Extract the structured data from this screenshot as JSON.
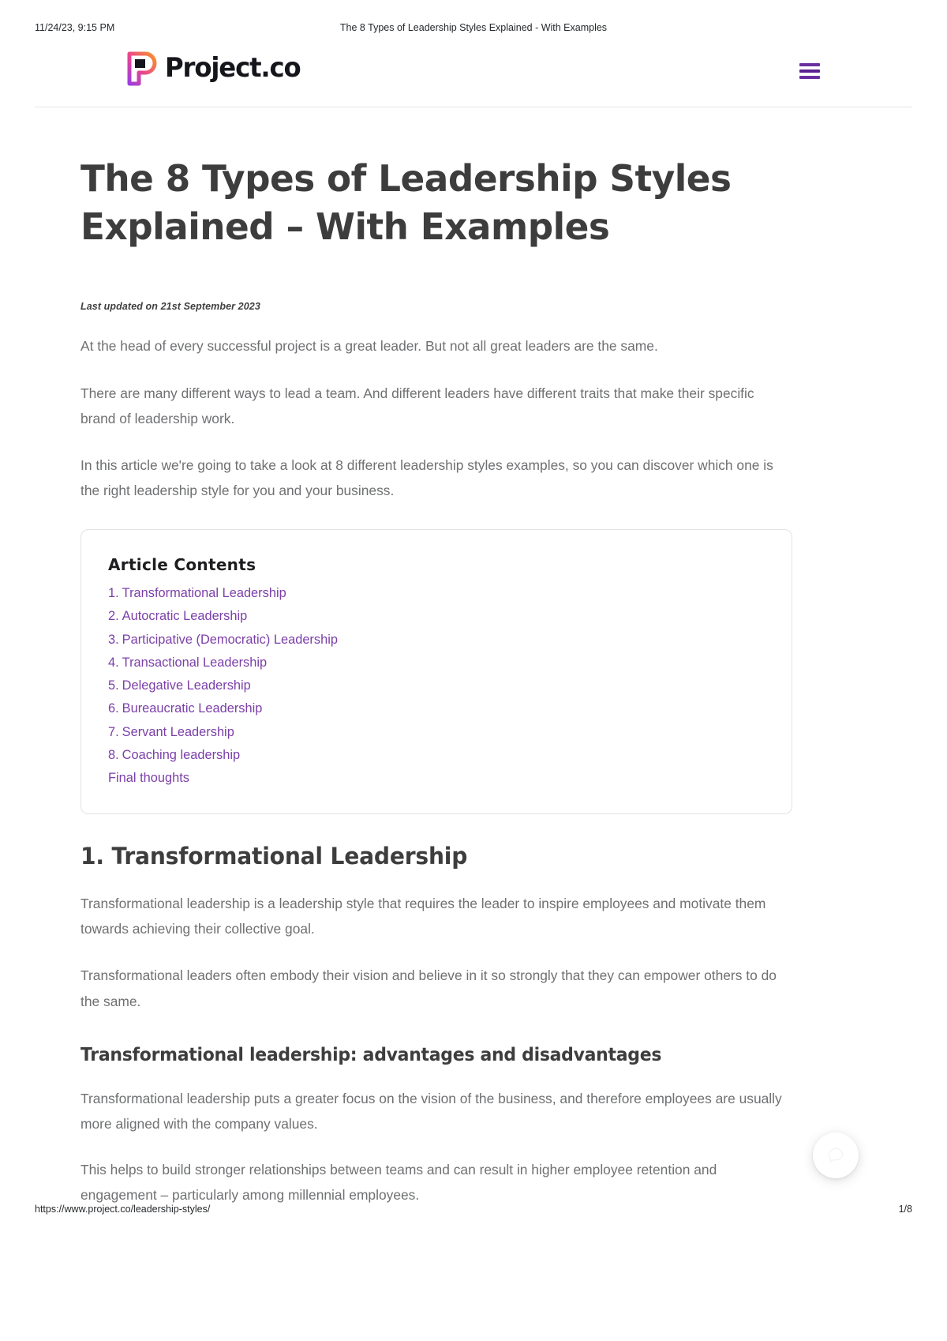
{
  "print": {
    "date": "11/24/23, 9:15 PM",
    "doc_title": "The 8 Types of Leadership Styles Explained - With Examples",
    "url": "https://www.project.co/leadership-styles/",
    "page_number": "1/8"
  },
  "header": {
    "brand_name": "Project.co",
    "logo_icon": "project-co-p-mark",
    "menu_icon": "hamburger-menu-icon",
    "accent_purple": "#6b2fa0",
    "logo_gradient": [
      "#a33bd8",
      "#ef4b8d",
      "#f98b2c"
    ]
  },
  "article": {
    "title": "The 8 Types of Leadership Styles Explained – With Examples",
    "updated": "Last updated on 21st September 2023",
    "intro_paragraphs": [
      "At the head of every successful project is a great leader. But not all great leaders are the same.",
      "There are many different ways to lead a team. And different leaders have different traits that make their specific brand of leadership work.",
      "In this article we're going to take a look at 8 different leadership styles examples, so you can discover which one is the right leadership style for you and your business."
    ],
    "contents": {
      "heading": "Article Contents",
      "items": [
        {
          "num": "1.",
          "label": "Transformational Leadership"
        },
        {
          "num": "2.",
          "label": "Autocratic Leadership"
        },
        {
          "num": "3.",
          "label": "Participative (Democratic) Leadership"
        },
        {
          "num": "4.",
          "label": "Transactional Leadership"
        },
        {
          "num": "5.",
          "label": "Delegative Leadership"
        },
        {
          "num": "6.",
          "label": "Bureaucratic Leadership"
        },
        {
          "num": "7.",
          "label": "Servant Leadership"
        },
        {
          "num": "8.",
          "label": "Coaching leadership"
        },
        {
          "num": "",
          "label": "Final thoughts"
        }
      ],
      "link_color": "#7b3fa8"
    },
    "sections": [
      {
        "heading": "1. Transformational Leadership",
        "paragraphs": [
          "Transformational leadership is a leadership style that requires the leader to inspire employees and motivate them towards achieving their collective goal.",
          "Transformational leaders often embody their vision and believe in it so strongly that they can empower others to do the same."
        ],
        "subheading": "Transformational leadership: advantages and disadvantages",
        "sub_paragraphs": [
          "Transformational leadership puts a greater focus on the vision of the business, and therefore employees are usually more aligned with the company values.",
          "This helps to build stronger relationships between teams and can result in higher employee retention and engagement – particularly among millennial employees."
        ]
      }
    ]
  },
  "chat_widget": {
    "icon": "chat-bubble-icon",
    "label": "Open chat"
  }
}
